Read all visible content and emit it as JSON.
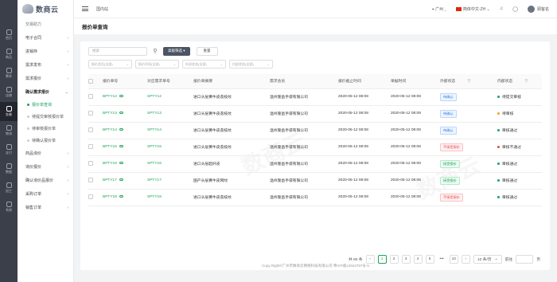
{
  "rail": [
    {
      "label": "首页"
    },
    {
      "label": "商品"
    },
    {
      "label": "需求"
    },
    {
      "label": "店铺"
    },
    {
      "label": "交易"
    },
    {
      "label": "物流"
    },
    {
      "label": "支付"
    },
    {
      "label": "数据"
    },
    {
      "label": "加工"
    },
    {
      "label": "系统"
    }
  ],
  "rail_active": 4,
  "logo": {
    "text": "数商云"
  },
  "menu": {
    "section": "交易助力",
    "items_before": [
      "电子合同",
      "进销存",
      "需求发布",
      "需求报价"
    ],
    "open": "确认需求报价",
    "sub": [
      "报价单查询",
      "待提交审核报价单",
      "待审核报价单",
      "待确认报价单"
    ],
    "sub_active": 0,
    "items_after": [
      "商品询价",
      "询价报价",
      "确认询价品报价",
      "采购订单",
      "销售订单"
    ]
  },
  "header": {
    "breadcrumb": "国内站",
    "location": "广州",
    "language": "简体中文-ZH",
    "username": "顾客名"
  },
  "page_title": "报价单查询",
  "filters": {
    "search_placeholder": "搜索",
    "advanced_label": "高级筛选 ▾",
    "reset_label": "重置",
    "selects": [
      "报价会员(全部)",
      "报价时间(全部)",
      "外部状态(全部)",
      "内部状态(全部)"
    ]
  },
  "table": {
    "headers": [
      "报价单号",
      "对应需求单号",
      "报价单摘要",
      "需求会员",
      "报价截止时间",
      "单据时间",
      "外部状态",
      "内部状态"
    ],
    "rows": [
      {
        "no": "BPTY12",
        "req": "SPTY12",
        "summary": "进口头层黄牛皮荔枝纹",
        "member": "温州隆昌手袋有限公司",
        "deadline": "2020-05-12 08:08",
        "time": "2020-05-12 08:08",
        "ext": "待确认",
        "ext_type": "blue",
        "int": "待提交审核",
        "int_color": "#1aa35a"
      },
      {
        "no": "BPTY13",
        "req": "SPTY13",
        "summary": "进口头层黄牛皮荔枝纹",
        "member": "温州隆昌手袋有限公司",
        "deadline": "2020-05-12 08:08",
        "time": "2020-05-12 08:08",
        "ext": "待确认",
        "ext_type": "blue",
        "int": "待审核",
        "int_color": "#f0a020"
      },
      {
        "no": "BPTY14",
        "req": "SPTY14",
        "summary": "进口头层黄牛皮荔枝纹",
        "member": "温州隆昌手袋有限公司",
        "deadline": "2020-05-12 08:08",
        "time": "2020-05-12 08:08",
        "ext": "待确认",
        "ext_type": "blue",
        "int": "审核通过",
        "int_color": "#1aa35a"
      },
      {
        "no": "BPTY15",
        "req": "SPTY15",
        "summary": "进口头层黄牛皮荔枝纹",
        "member": "温州隆昌手袋有限公司",
        "deadline": "2020-05-12 08:08",
        "time": "2020-05-12 08:08",
        "ext": "不接受报价",
        "ext_type": "red",
        "int": "审核不通过",
        "int_color": "#e5484d"
      },
      {
        "no": "BPTY16",
        "req": "SPTY16",
        "summary": "进口头层超纤皮",
        "member": "温州隆昌手袋有限公司",
        "deadline": "2020-05-12 08:08",
        "time": "2020-05-12 08:08",
        "ext": "接受报价",
        "ext_type": "green",
        "int": "审核通过",
        "int_color": "#1aa35a"
      },
      {
        "no": "BPTY17",
        "req": "SPTY17",
        "summary": "国产头层黄牛皮网纹",
        "member": "温州隆昌手袋有限公司",
        "deadline": "2020-05-12 08:08",
        "time": "2020-05-12 08:08",
        "ext": "接受报价",
        "ext_type": "green",
        "int": "审核通过",
        "int_color": "#1aa35a"
      },
      {
        "no": "BPTY18",
        "req": "SPTY18",
        "summary": "进口头层黄牛皮荔枝纹",
        "member": "温州隆昌手袋有限公司",
        "deadline": "2020-05-12 08:08",
        "time": "2020-05-12 08:08",
        "ext": "不接受报价",
        "ext_type": "red",
        "int": "审核通过",
        "int_color": "#1aa35a"
      }
    ]
  },
  "pager": {
    "total": "共 80 条",
    "pages": [
      "1",
      "2",
      "3",
      "4",
      "5",
      "•••",
      "10"
    ],
    "active": "1",
    "size": "10 条/页",
    "goto": "前往",
    "unit": "页"
  },
  "footer": "Copy Right©广州市数商云网络科技有限公司 粤ICP备13044797号-5",
  "watermark": "数商云"
}
